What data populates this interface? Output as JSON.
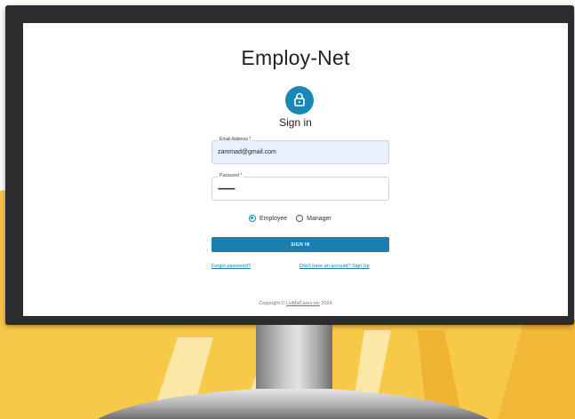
{
  "app": {
    "title": "Employ-Net"
  },
  "login": {
    "heading": "Sign in",
    "email": {
      "label": "Email Address *",
      "value": "zammad@gmail.com"
    },
    "password": {
      "label": "Password *",
      "value": "•••••••••••••••••"
    },
    "roles": [
      {
        "label": "Employee",
        "selected": true
      },
      {
        "label": "Manager",
        "selected": false
      }
    ],
    "submit_label": "SIGN IN",
    "forgot_link": "Forgot password?",
    "signup_link": "Don't have an account? Sign Up"
  },
  "footer": {
    "prefix": "Copyright © ",
    "company": "LizMaCares.inc",
    "year": "2024"
  },
  "colors": {
    "accent": "#1a7fae",
    "autofill": "#e8f0fe",
    "bezel": "#2c2c2e",
    "background_yellow": "#f7c948"
  }
}
